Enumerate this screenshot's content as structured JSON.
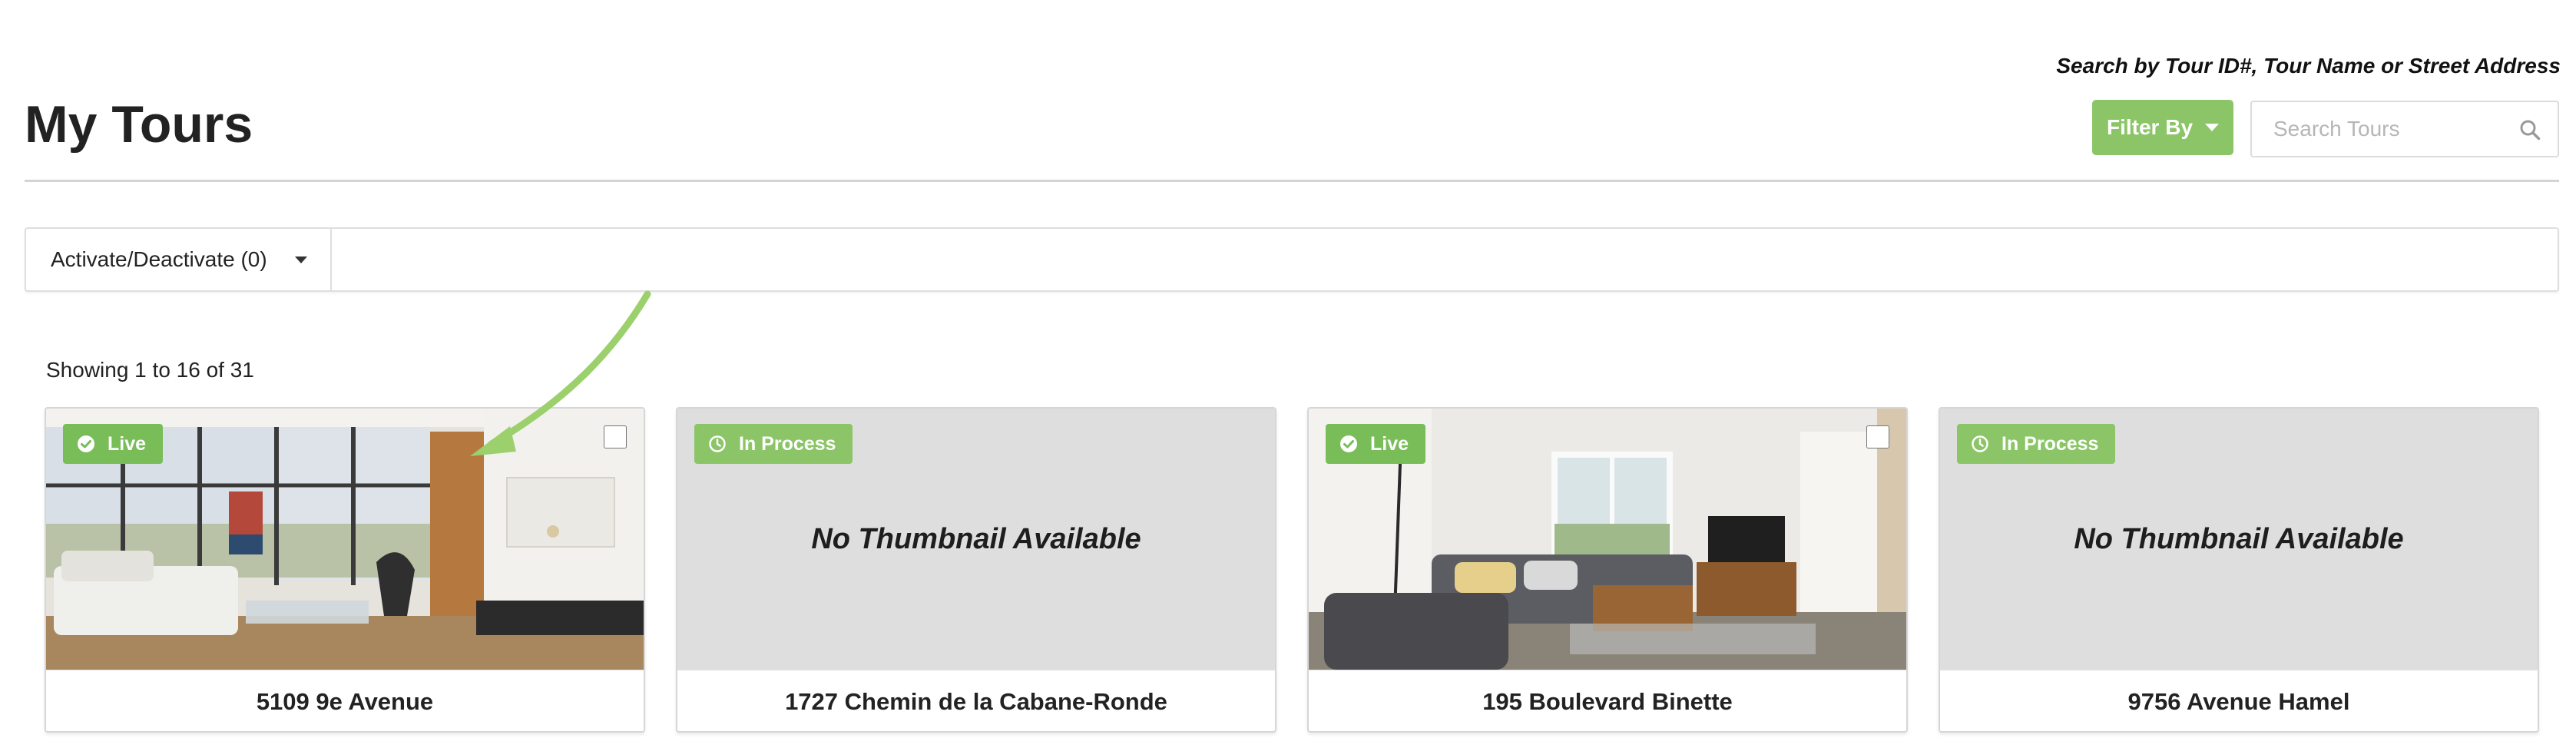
{
  "header": {
    "title": "My Tours",
    "search_hint": "Search by Tour ID#, Tour Name or Street Address",
    "filter_button_label": "Filter By",
    "search_placeholder": "Search Tours",
    "search_value": ""
  },
  "bulk_actions": {
    "dropdown_label": "Activate/Deactivate (0)"
  },
  "results": {
    "showing_text": "Showing 1 to 16 of 31"
  },
  "no_thumbnail_text": "No Thumbnail Available",
  "colors": {
    "accent_green": "#8cc567",
    "live_badge": "#78bd58",
    "placeholder_bg": "#dedede",
    "arrow_green": "#9bd06c"
  },
  "tours": [
    {
      "title": "5109 9e Avenue",
      "status": "Live",
      "status_icon": "check-circle-icon",
      "has_thumbnail": true
    },
    {
      "title": "1727 Chemin de la Cabane-Ronde",
      "status": "In Process",
      "status_icon": "clock-icon",
      "has_thumbnail": false
    },
    {
      "title": "195 Boulevard Binette",
      "status": "Live",
      "status_icon": "check-circle-icon",
      "has_thumbnail": true
    },
    {
      "title": "9756 Avenue Hamel",
      "status": "In Process",
      "status_icon": "clock-icon",
      "has_thumbnail": false
    }
  ]
}
